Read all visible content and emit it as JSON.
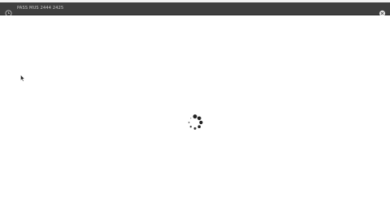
{
  "window": {
    "title": "PASS MUS 2444 2425",
    "left_icon": "clock-icon",
    "right_icon": "close-circle-icon"
  },
  "content": {
    "state": "loading",
    "spinner_icon": "loading-spinner-icon",
    "pointer_icon": "mouse-pointer-icon"
  },
  "colors": {
    "titlebar": "#3f3f3f",
    "background": "#ffffff",
    "spinner": "#222222"
  }
}
